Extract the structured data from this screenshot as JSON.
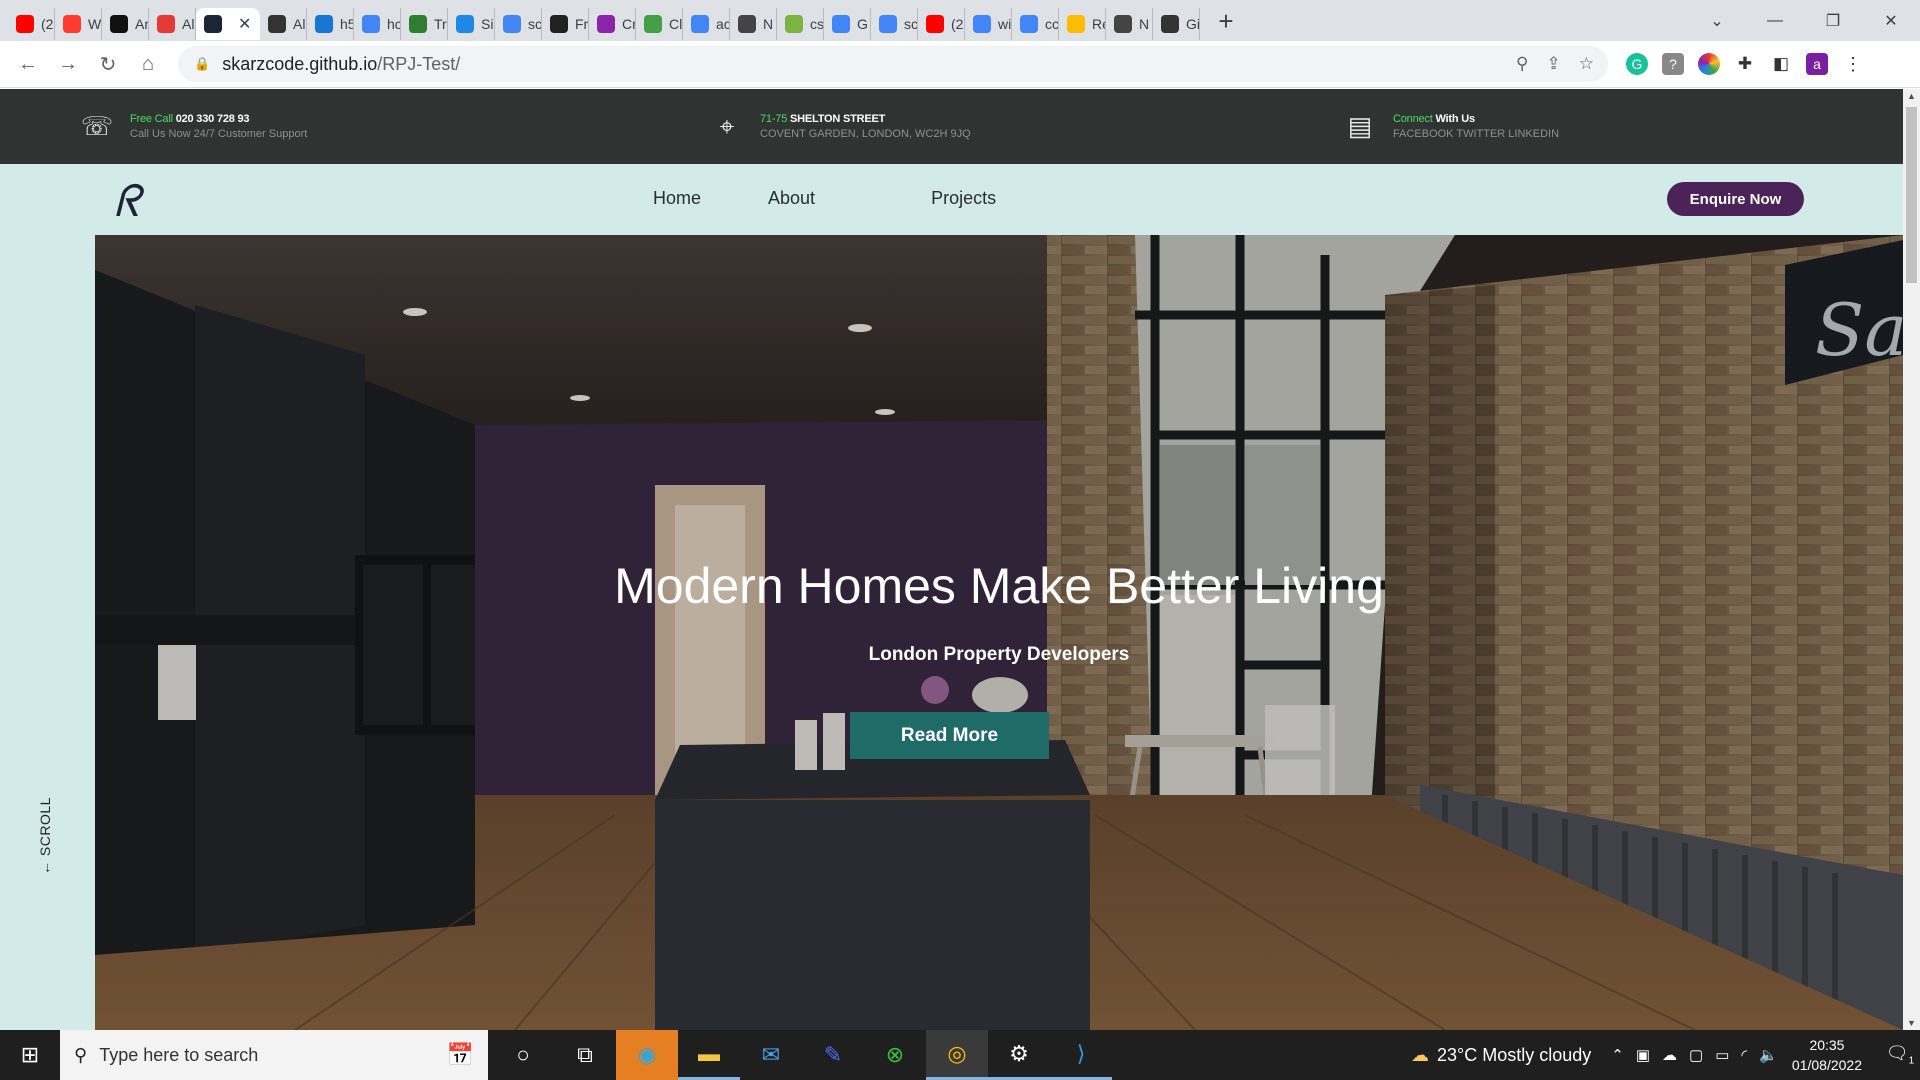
{
  "browser": {
    "tabs": [
      {
        "icon": "youtube-icon",
        "title": "(2",
        "color": "#ff0000"
      },
      {
        "icon": "youtube-play-icon",
        "title": "W",
        "color": "#ff3b30"
      },
      {
        "icon": "amazon-icon",
        "title": "Ar",
        "color": "#111111"
      },
      {
        "icon": "crown-icon",
        "title": "Al",
        "color": "#e53935"
      },
      {
        "icon": "site-logo-icon",
        "title": "",
        "color": "#1d2436"
      },
      {
        "icon": "globe-icon",
        "title": "Al",
        "color": "#333333"
      },
      {
        "icon": "page-icon",
        "title": "h5",
        "color": "#1976d2"
      },
      {
        "icon": "google-icon",
        "title": "hc",
        "color": "#4285f4"
      },
      {
        "icon": "w-icon",
        "title": "Tr",
        "color": "#2e7d32"
      },
      {
        "icon": "c-icon",
        "title": "Si",
        "color": "#1e88e5"
      },
      {
        "icon": "google-icon",
        "title": "sc",
        "color": "#4285f4"
      },
      {
        "icon": "briefcase-icon",
        "title": "Fr",
        "color": "#222222"
      },
      {
        "icon": "u-icon",
        "title": "Cr",
        "color": "#8e24aa"
      },
      {
        "icon": "dots-icon",
        "title": "Cl",
        "color": "#43a047"
      },
      {
        "icon": "google-icon",
        "title": "ac",
        "color": "#4285f4"
      },
      {
        "icon": "openai-icon",
        "title": "N",
        "color": "#444444"
      },
      {
        "icon": "sparkle-icon",
        "title": "cs",
        "color": "#7cb342"
      },
      {
        "icon": "google-icon",
        "title": "G",
        "color": "#4285f4"
      },
      {
        "icon": "google-icon",
        "title": "sc",
        "color": "#4285f4"
      },
      {
        "icon": "youtube-icon",
        "title": "(2",
        "color": "#ff0000"
      },
      {
        "icon": "google-icon",
        "title": "wi",
        "color": "#4285f4"
      },
      {
        "icon": "google-icon",
        "title": "cc",
        "color": "#4285f4"
      },
      {
        "icon": "drive-icon",
        "title": "Re",
        "color": "#fbbc04"
      },
      {
        "icon": "openai-icon",
        "title": "N",
        "color": "#444444"
      },
      {
        "icon": "github-icon",
        "title": "Gi",
        "color": "#333333"
      }
    ],
    "active_tab_index": 4,
    "url_host": "skarzcode.github.io",
    "url_path": "/RPJ-Test/",
    "profile_initial": "a"
  },
  "topbar": {
    "phone": {
      "accent": "Free Call",
      "main": "020 330 728 93",
      "sub": "Call Us Now 24/7 Customer Support"
    },
    "address": {
      "accent": "71-75",
      "main": "SHELTON STREET",
      "sub": "COVENT GARDEN, LONDON, WC2H 9JQ"
    },
    "social": {
      "accent": "Connect",
      "main": "With Us",
      "sub": "FACEBOOK TWITTER LINKEDIN"
    }
  },
  "navbar": {
    "logo": "ᖇ",
    "menu": [
      "Home",
      "About",
      "Projects"
    ],
    "cta": "Enquire Now"
  },
  "rail": {
    "scroll_label": "← SCROLL"
  },
  "hero": {
    "title": "Modern Homes Make Better Living",
    "subtitle": "London Property Developers",
    "button": "Read More"
  },
  "taskbar": {
    "search_placeholder": "Type here to search",
    "weather": "23°C  Mostly cloudy",
    "time": "20:35",
    "date": "01/08/2022",
    "notification_count": "1"
  }
}
